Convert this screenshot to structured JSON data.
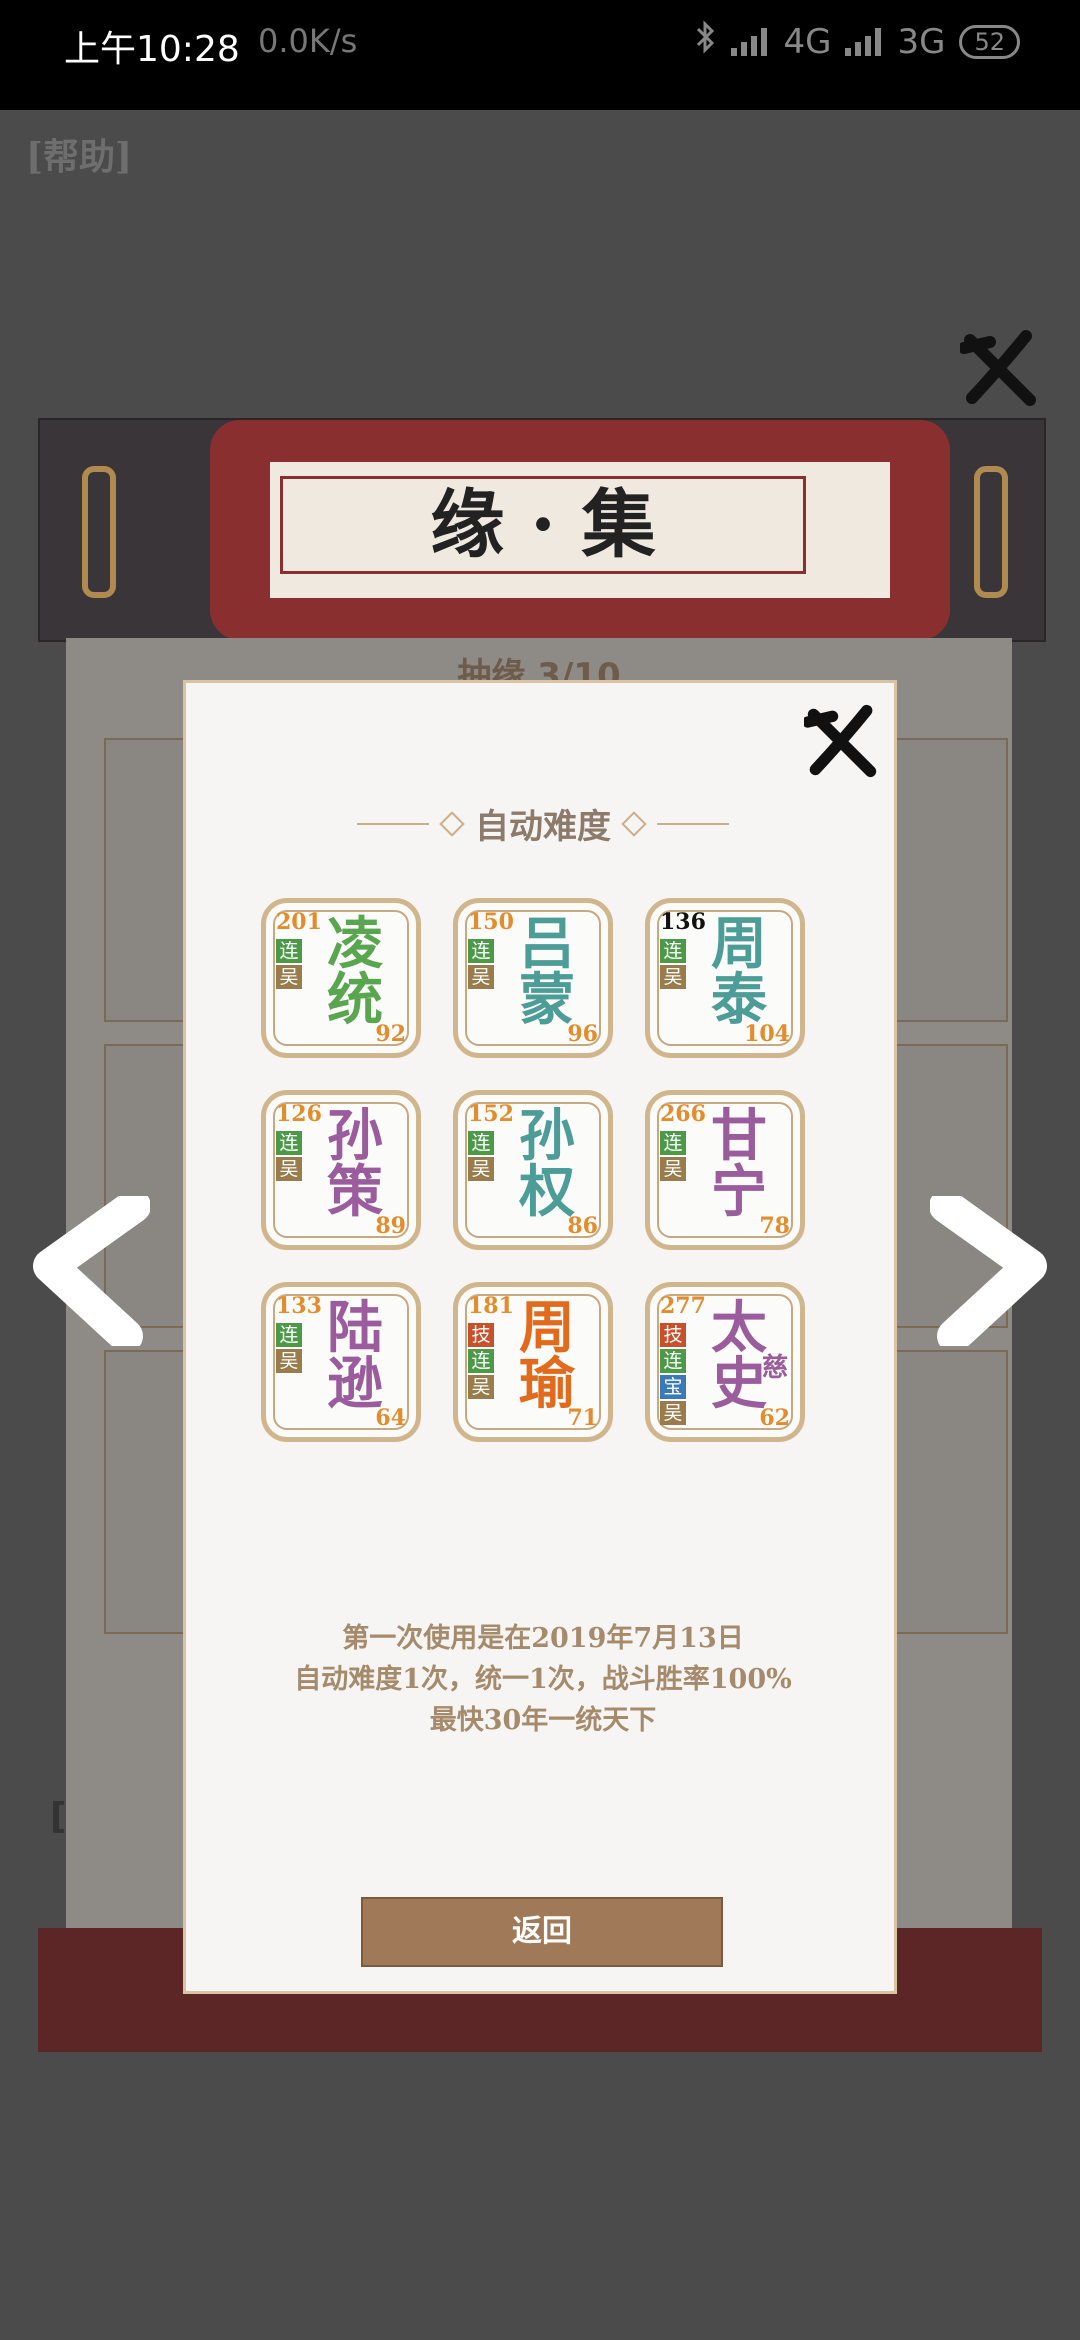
{
  "status_bar": {
    "time": "上午10:28",
    "speed": "0.0K/s",
    "network_1": "4G",
    "network_2": "3G",
    "battery": "52"
  },
  "background": {
    "help": "[帮助]",
    "banner_title": "缘 · 集",
    "draw_label": "抽缘  3/10",
    "side_bracket": "["
  },
  "modal": {
    "title": "自动难度",
    "cards": [
      {
        "num": "201",
        "tags": [
          "连",
          "吴"
        ],
        "name1": "凌",
        "name2": "统",
        "power": "92",
        "color": "green"
      },
      {
        "num": "150",
        "tags": [
          "连",
          "吴"
        ],
        "name1": "吕",
        "name2": "蒙",
        "power": "96",
        "color": "teal"
      },
      {
        "num": "136",
        "tags": [
          "连",
          "吴"
        ],
        "name1": "周",
        "name2": "泰",
        "power": "104",
        "color": "teal",
        "num_dark": true
      },
      {
        "num": "126",
        "tags": [
          "连",
          "吴"
        ],
        "name1": "孙",
        "name2": "策",
        "power": "89",
        "color": "purple"
      },
      {
        "num": "152",
        "tags": [
          "连",
          "吴"
        ],
        "name1": "孙",
        "name2": "权",
        "power": "86",
        "color": "teal"
      },
      {
        "num": "266",
        "tags": [
          "连",
          "吴"
        ],
        "name1": "甘",
        "name2": "宁",
        "power": "78",
        "color": "purple"
      },
      {
        "num": "133",
        "tags": [
          "连",
          "吴"
        ],
        "name1": "陆",
        "name2": "逊",
        "power": "64",
        "color": "purple"
      },
      {
        "num": "181",
        "tags": [
          "技",
          "连",
          "吴"
        ],
        "name1": "周",
        "name2": "瑜",
        "power": "71",
        "color": "orange"
      },
      {
        "num": "277",
        "tags": [
          "技",
          "连",
          "宝",
          "吴"
        ],
        "name1": "太",
        "name2": "史",
        "power": "62",
        "color": "purple",
        "extra": "慈"
      }
    ],
    "info_line1": "第一次使用是在2019年7月13日",
    "info_line2": "自动难度1次，统一1次，战斗胜率100%",
    "info_line3": "最快30年一统天下",
    "back_button": "返回"
  },
  "colors": {
    "card_border": "#d1b58d",
    "number": "#e38c2c",
    "tag_lian": "#4c9a48",
    "tag_wu": "#9a7b4c",
    "tag_ji": "#c8502a",
    "tag_bao": "#3a7ab8",
    "button": "#a07a58"
  },
  "icons": [
    "close-x-icon",
    "left-arrow-icon",
    "right-arrow-icon",
    "bluetooth-icon",
    "signal-icon"
  ]
}
